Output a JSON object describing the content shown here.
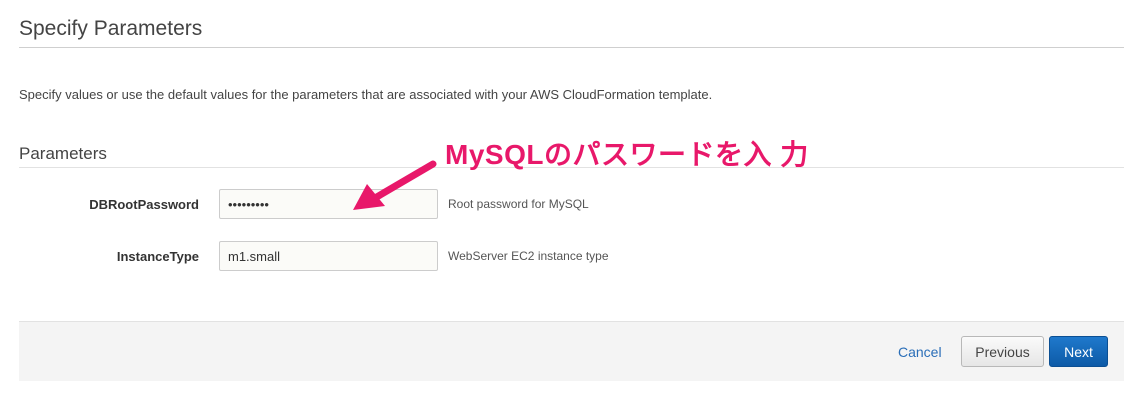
{
  "page": {
    "title": "Specify Parameters",
    "intro": "Specify values or use the default values for the parameters that are associated with your AWS CloudFormation template."
  },
  "parameters": {
    "section_title": "Parameters",
    "items": [
      {
        "label": "DBRootPassword",
        "value": "dummy-pw1",
        "hint": "Root password for MySQL"
      },
      {
        "label": "InstanceType",
        "value": "m1.small",
        "hint": "WebServer EC2 instance type"
      }
    ]
  },
  "annotation": {
    "text": "MySQLのパスワードを入 力",
    "color": "#e8186a"
  },
  "footer": {
    "cancel_label": "Cancel",
    "previous_label": "Previous",
    "next_label": "Next"
  },
  "colors": {
    "link": "#2a6eb8",
    "primary_button": "#1066b8"
  }
}
